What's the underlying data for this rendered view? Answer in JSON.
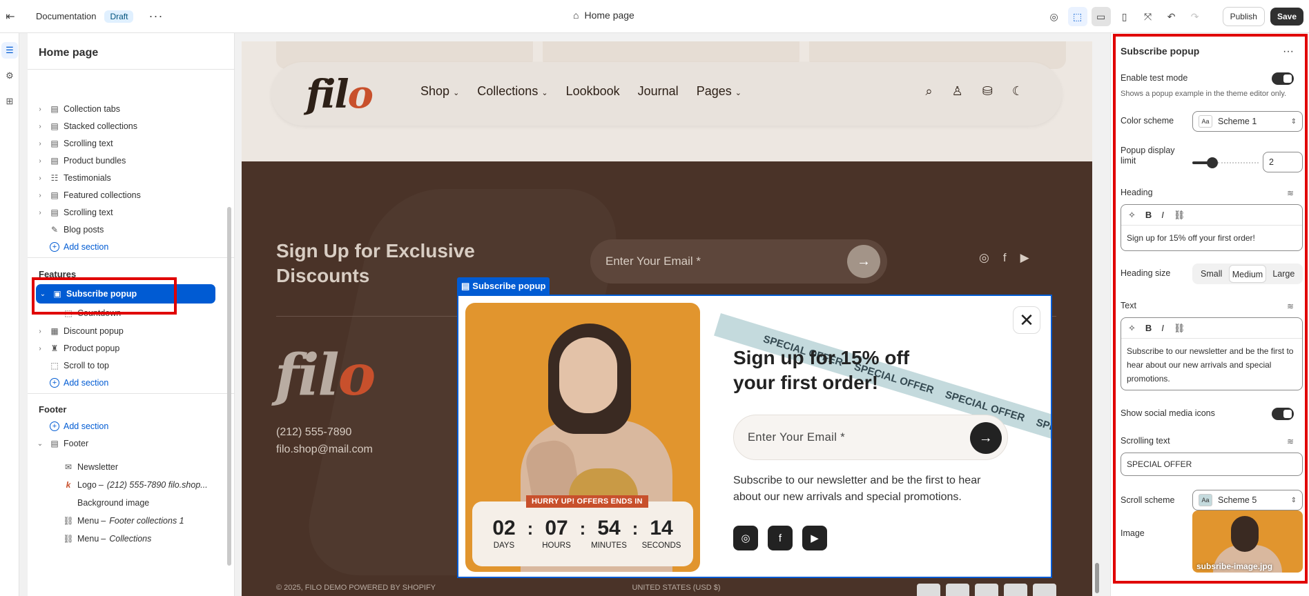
{
  "topbar": {
    "doc_label": "Documentation",
    "draft_badge": "Draft",
    "page_title": "Home page",
    "publish_label": "Publish",
    "save_label": "Save"
  },
  "sidebar": {
    "title": "Home page",
    "template_items": [
      {
        "label": "Collection tabs",
        "icon": "section-icon"
      },
      {
        "label": "Stacked collections",
        "icon": "section-icon"
      },
      {
        "label": "Scrolling text",
        "icon": "section-icon"
      },
      {
        "label": "Product bundles",
        "icon": "section-icon"
      },
      {
        "label": "Testimonials",
        "icon": "list-icon"
      },
      {
        "label": "Featured collections",
        "icon": "section-icon"
      },
      {
        "label": "Scrolling text",
        "icon": "section-icon"
      },
      {
        "label": "Blog posts",
        "icon": "edit-icon"
      }
    ],
    "add_section": "Add section",
    "features_header": "Features",
    "features_items": [
      {
        "label": "Subscribe popup",
        "icon": "popup-icon",
        "selected": true
      },
      {
        "label": "Countdown",
        "icon": "block-icon",
        "child": true
      },
      {
        "label": "Discount popup",
        "icon": "gift-icon"
      },
      {
        "label": "Product popup",
        "icon": "tshirt-icon"
      },
      {
        "label": "Scroll to top",
        "icon": "block-icon"
      }
    ],
    "footer_header": "Footer",
    "footer_items": [
      {
        "label": "Footer",
        "icon": "section-icon"
      },
      {
        "label": "Newsletter",
        "icon": "mail-icon"
      },
      {
        "label": "Logo",
        "sub": "(212) 555-7890 filo.shop...",
        "icon": "logo-k-icon"
      },
      {
        "label": "Background image",
        "icon": "image-icon"
      },
      {
        "label": "Menu",
        "sub": "Footer collections 1",
        "icon": "link-icon"
      },
      {
        "label": "Menu",
        "sub": "Collections",
        "icon": "link-icon"
      }
    ]
  },
  "site": {
    "nav": [
      "Shop",
      "Collections",
      "Lookbook",
      "Journal",
      "Pages"
    ],
    "nav_has_dropdown": [
      true,
      true,
      false,
      false,
      true
    ],
    "logo_left": "fil",
    "logo_right": "o",
    "footer_heading": "Sign Up for Exclusive Discounts",
    "footer_email_placeholder": "Enter Your Email *",
    "phone": "(212) 555-7890",
    "email": "filo.shop@mail.com",
    "copyright": "© 2025, FILO DEMO POWERED BY SHOPIFY",
    "currency": "UNITED STATES (USD $)"
  },
  "popup": {
    "editor_label": "Subscribe popup",
    "hurry": "HURRY UP! OFFERS ENDS IN",
    "countdown": [
      {
        "value": "02",
        "label": "DAYS"
      },
      {
        "value": "07",
        "label": "HOURS"
      },
      {
        "value": "54",
        "label": "MINUTES"
      },
      {
        "value": "14",
        "label": "SECONDS"
      }
    ],
    "ribbon_text": "SPECIAL OFFER",
    "heading": "Sign up for 15% off your first order!",
    "email_placeholder": "Enter Your Email *",
    "text": "Subscribe to our newsletter and be the first to hear about our new arrivals and special promotions."
  },
  "settings": {
    "title": "Subscribe popup",
    "test_mode_label": "Enable test mode",
    "test_mode_help": "Shows a popup example in the theme editor only.",
    "test_mode_on": true,
    "color_scheme_label": "Color scheme",
    "color_scheme_value": "Scheme 1",
    "display_limit_label": "Popup display limit",
    "display_limit_value": "2",
    "display_limit_fraction": 0.3,
    "heading_label": "Heading",
    "heading_value": "Sign up for 15% off your first order!",
    "heading_size_label": "Heading size",
    "heading_sizes": [
      "Small",
      "Medium",
      "Large"
    ],
    "heading_size_selected": "Medium",
    "text_label": "Text",
    "text_value": "Subscribe to our newsletter and be the first to hear about our new arrivals and special promotions.",
    "social_label": "Show social media icons",
    "social_on": true,
    "scrolling_label": "Scrolling text",
    "scrolling_value": "SPECIAL OFFER",
    "scroll_scheme_label": "Scroll scheme",
    "scroll_scheme_value": "Scheme 5",
    "image_label": "Image",
    "image_name": "subsribe-image.jpg"
  },
  "colors": {
    "accent": "#005bd3",
    "highlight": "#e00000",
    "footer_bg": "#4a3328",
    "brand_orange": "#c8502c"
  }
}
